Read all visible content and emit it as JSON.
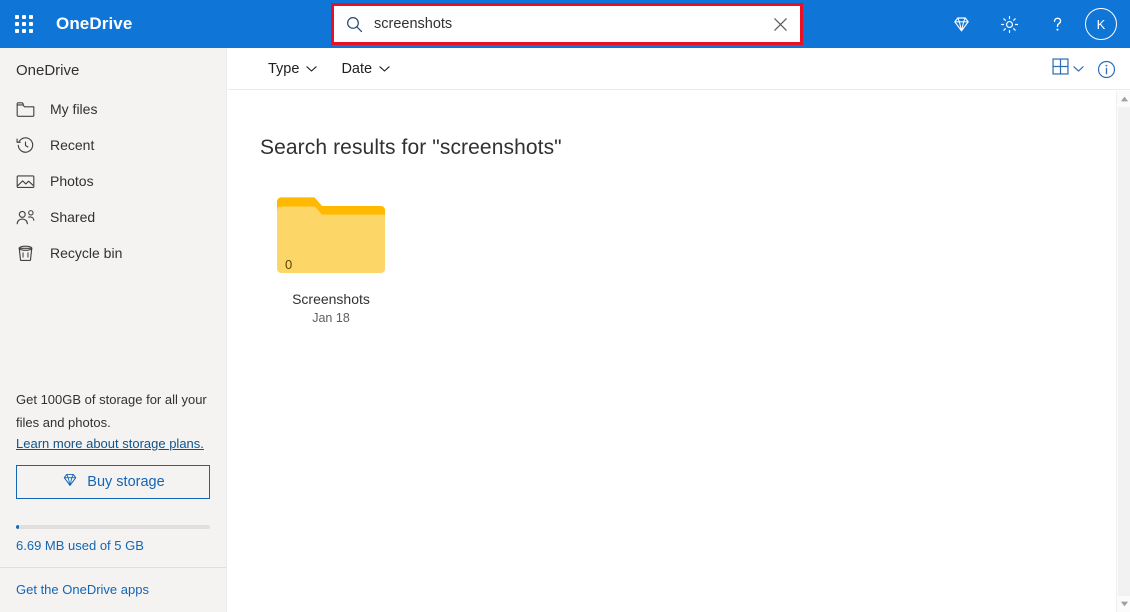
{
  "suite": {
    "waffle_label": "app-launcher",
    "brand": "OneDrive",
    "icons": [
      {
        "name": "diamond-icon",
        "label": "Premium"
      },
      {
        "name": "gear-icon",
        "label": "Settings"
      },
      {
        "name": "help-icon",
        "label": "Help"
      }
    ],
    "avatar_initial": "K"
  },
  "search": {
    "value": "screenshots",
    "placeholder": "Search everything",
    "search_icon": "search-icon",
    "clear_icon": "close-icon",
    "highlight_color": "#e81123"
  },
  "sidebar": {
    "title": "OneDrive",
    "items": [
      {
        "label": "My files",
        "icon": "folder-icon"
      },
      {
        "label": "Recent",
        "icon": "clock-icon"
      },
      {
        "label": "Photos",
        "icon": "photo-icon"
      },
      {
        "label": "Shared",
        "icon": "people-icon"
      },
      {
        "label": "Recycle bin",
        "icon": "trash-icon"
      }
    ],
    "storage": {
      "promo_line1": "Get 100GB of storage for all your",
      "promo_line2": "files and photos.",
      "learn_more": "Learn more about storage plans.",
      "buy_button": "Buy storage",
      "buy_icon": "diamond-icon",
      "used_label": "6.69 MB used of 5 GB",
      "used_percent": 0.13
    },
    "apps_link": "Get the OneDrive apps"
  },
  "commandbar": {
    "filters": [
      {
        "label": "Type",
        "icon": "chevron-down-icon"
      },
      {
        "label": "Date",
        "icon": "chevron-down-icon"
      }
    ],
    "view_icon": "grid-view-icon",
    "view_chevron": "chevron-down-icon",
    "info_icon": "info-icon"
  },
  "main": {
    "heading": "Search results for \"screenshots\"",
    "items": [
      {
        "name": "Screenshots",
        "date": "Jan 18",
        "count": "0",
        "type": "folder",
        "folder_tab_color": "#ffb900",
        "folder_body_color": "#fcd667"
      }
    ]
  },
  "scrollbar": {
    "up_icon": "caret-up-icon",
    "down_icon": "caret-down-icon"
  }
}
